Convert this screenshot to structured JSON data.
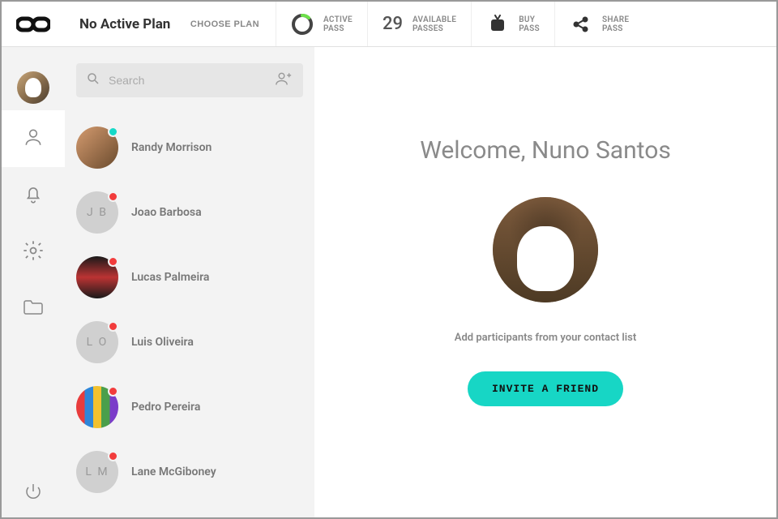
{
  "header": {
    "plan_title": "No Active Plan",
    "choose_plan_label": "CHOOSE PLAN",
    "active_pass": {
      "line1": "ACTIVE",
      "line2": "PASS"
    },
    "available_passes": {
      "count": "29",
      "line1": "AVAILABLE",
      "line2": "PASSES"
    },
    "buy_pass": {
      "line1": "BUY",
      "line2": "PASS"
    },
    "share_pass": {
      "line1": "SHARE",
      "line2": "PASS"
    }
  },
  "search": {
    "placeholder": "Search"
  },
  "contacts": [
    {
      "name": "Randy Morrison",
      "initials": "",
      "status": "online",
      "avatar_kind": "photo1"
    },
    {
      "name": "Joao Barbosa",
      "initials": "J B",
      "status": "offline",
      "avatar_kind": "initials"
    },
    {
      "name": "Lucas Palmeira",
      "initials": "",
      "status": "offline",
      "avatar_kind": "photo2"
    },
    {
      "name": "Luis Oliveira",
      "initials": "L O",
      "status": "offline",
      "avatar_kind": "initials"
    },
    {
      "name": "Pedro Pereira",
      "initials": "",
      "status": "offline",
      "avatar_kind": "stripes"
    },
    {
      "name": "Lane McGiboney",
      "initials": "L M",
      "status": "offline",
      "avatar_kind": "initials"
    }
  ],
  "welcome": {
    "heading": "Welcome, Nuno Santos",
    "subtext": "Add participants from your contact list",
    "invite_label": "INVITE A FRIEND"
  }
}
